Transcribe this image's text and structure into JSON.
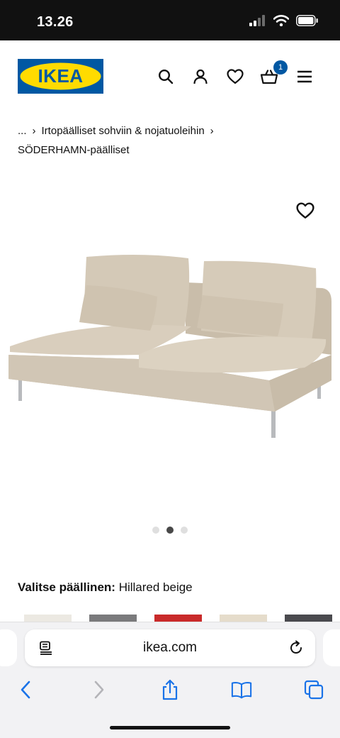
{
  "status_bar": {
    "time": "13.26"
  },
  "header": {
    "logo_text": "IKEA",
    "cart_count": "1",
    "icons": [
      "search-icon",
      "user-icon",
      "heart-icon",
      "basket-icon",
      "menu-icon"
    ]
  },
  "breadcrumb": {
    "ellipsis": "...",
    "parent": "Irtopäälliset sohviin & nojatuoleihin",
    "current": "SÖDERHAMN-päälliset"
  },
  "carousel": {
    "total": 3,
    "active": 2
  },
  "cover": {
    "label": "Valitse päällinen:",
    "value": "Hillared beige",
    "swatch_colors": [
      "#ece9e2",
      "#7a7a7c",
      "#c92a2a",
      "#e5dccb",
      "#4a4a4e"
    ]
  },
  "browser": {
    "url": "ikea.com",
    "toolbar_icons": [
      "back-icon",
      "forward-icon",
      "share-icon",
      "bookmarks-icon",
      "tabs-icon"
    ]
  },
  "colors": {
    "accent": "#0058a3",
    "logo_blue": "#0058a3",
    "logo_yellow": "#ffdb00",
    "sofa": "#cbbfad"
  }
}
